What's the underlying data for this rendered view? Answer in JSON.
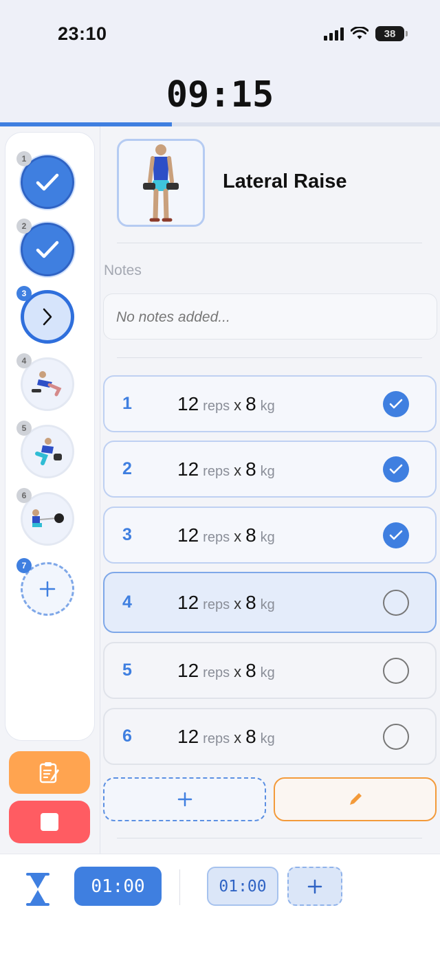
{
  "status_bar": {
    "time": "23:10",
    "battery": "38"
  },
  "workout": {
    "elapsed": "09:15",
    "progress_percent": 39
  },
  "exercise_list": [
    {
      "number": "1",
      "state": "done"
    },
    {
      "number": "2",
      "state": "done"
    },
    {
      "number": "3",
      "state": "current"
    },
    {
      "number": "4",
      "state": "todo"
    },
    {
      "number": "5",
      "state": "todo"
    },
    {
      "number": "6",
      "state": "todo"
    },
    {
      "number": "7",
      "state": "add"
    }
  ],
  "current_exercise": {
    "name": "Lateral Raise",
    "notes_label": "Notes",
    "notes_placeholder": "No notes added..."
  },
  "sets": [
    {
      "number": "1",
      "reps": "12",
      "reps_unit": "reps",
      "x": "x",
      "weight": "8",
      "weight_unit": "kg",
      "done": true
    },
    {
      "number": "2",
      "reps": "12",
      "reps_unit": "reps",
      "x": "x",
      "weight": "8",
      "weight_unit": "kg",
      "done": true
    },
    {
      "number": "3",
      "reps": "12",
      "reps_unit": "reps",
      "x": "x",
      "weight": "8",
      "weight_unit": "kg",
      "done": true
    },
    {
      "number": "4",
      "reps": "12",
      "reps_unit": "reps",
      "x": "x",
      "weight": "8",
      "weight_unit": "kg",
      "done": false
    },
    {
      "number": "5",
      "reps": "12",
      "reps_unit": "reps",
      "x": "x",
      "weight": "8",
      "weight_unit": "kg",
      "done": false
    },
    {
      "number": "6",
      "reps": "12",
      "reps_unit": "reps",
      "x": "x",
      "weight": "8",
      "weight_unit": "kg",
      "done": false
    }
  ],
  "rest_timer": {
    "primary": "01:00",
    "secondary": "01:00"
  },
  "icons": {
    "add": "plus-icon",
    "edit": "pencil-icon",
    "notes": "clipboard-icon",
    "stop": "stop-icon",
    "timer": "hourglass-icon",
    "check": "checkmark-icon",
    "next": "chevron-right-icon"
  },
  "colors": {
    "accent": "#3f7fe0",
    "notes_button": "#ffa450",
    "stop_button": "#ff5c62",
    "edit_border": "#f39a3a"
  }
}
